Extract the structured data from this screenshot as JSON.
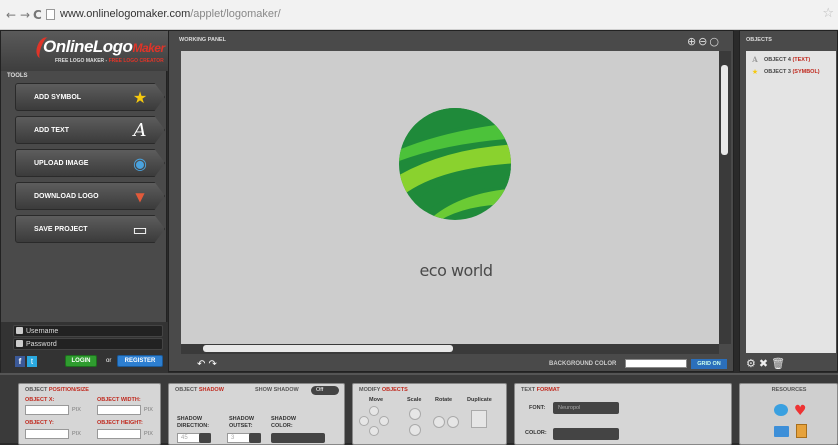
{
  "browser": {
    "back": "←",
    "forward": "→",
    "reload": "C",
    "url_host": "www.onlinelogomaker.com",
    "url_path": "/applet/logomaker/",
    "star": "☆"
  },
  "brand": {
    "title_main": "Online",
    "title_logo": "Logo",
    "title_maker": "Maker",
    "subtitle_a": "FREE LOGO MAKER",
    "subtitle_sep": " - ",
    "subtitle_b": "FREE LOGO CREATOR"
  },
  "tools": {
    "label": "TOOLS",
    "items": [
      {
        "label": "ADD SYMBOL",
        "icon": "★",
        "icon_color": "#f6c90e"
      },
      {
        "label": "ADD TEXT",
        "icon": "A",
        "icon_color": "#ffffff"
      },
      {
        "label": "UPLOAD IMAGE",
        "icon": "◉",
        "icon_color": "#4aa3df"
      },
      {
        "label": "DOWNLOAD LOGO",
        "icon": "▼",
        "icon_color": "#e25a3a"
      },
      {
        "label": "SAVE PROJECT",
        "icon": "▭",
        "icon_color": "#ffffff"
      }
    ]
  },
  "login": {
    "username_placeholder": "Username",
    "password_placeholder": "Password",
    "facebook": "f",
    "twitter": "t",
    "login_label": "LOGIN",
    "or": "or",
    "register_label": "REGISTER"
  },
  "working": {
    "label": "WORKING PANEL",
    "zoom_icons": "⊕⊖○",
    "logo_text": "eco world",
    "undo": "↶ ↷",
    "bg_color_label": "BACKGROUND COLOR",
    "grid_label": "GRID ON"
  },
  "objects": {
    "label": "OBJECTS",
    "items": [
      {
        "prefix": "OBJECT 4 ",
        "type": "(TEXT)",
        "icon": "A"
      },
      {
        "prefix": "OBJECT 3 ",
        "type": "(SYMBOL)",
        "icon": "★"
      }
    ],
    "tools": "⚙✖🗑"
  },
  "bottom": {
    "position": {
      "title_a": "OBJECT ",
      "title_b": "POSITION/SIZE",
      "x_label": "OBJECT X:",
      "width_label": "OBJECT WIDTH:",
      "y_label": "OBJECT Y:",
      "height_label": "OBJECT HEIGHT:",
      "unit": "PIX"
    },
    "shadow": {
      "title_a": "OBJECT ",
      "title_b": "SHADOW",
      "show_label": "SHOW SHADOW",
      "toggle": "Off",
      "direction_label_1": "SHADOW",
      "direction_label_2": "DIRECTION:",
      "outset_label_1": "SHADOW",
      "outset_label_2": "OUTSET:",
      "color_label_1": "SHADOW",
      "color_label_2": "COLOR:",
      "direction_value": "45",
      "outset_value": "3"
    },
    "modify": {
      "title_a": "MODIFY ",
      "title_b": "OBJECTS",
      "move": "Move",
      "scale": "Scale",
      "rotate": "Rotate",
      "duplicate": "Duplicate"
    },
    "text_format": {
      "title_a": "TEXT ",
      "title_b": "FORMAT",
      "font_label": "FONT:",
      "font_value": "Neuropol",
      "color_label": "COLOR:"
    },
    "resources": {
      "label": "RESOURCES"
    }
  }
}
